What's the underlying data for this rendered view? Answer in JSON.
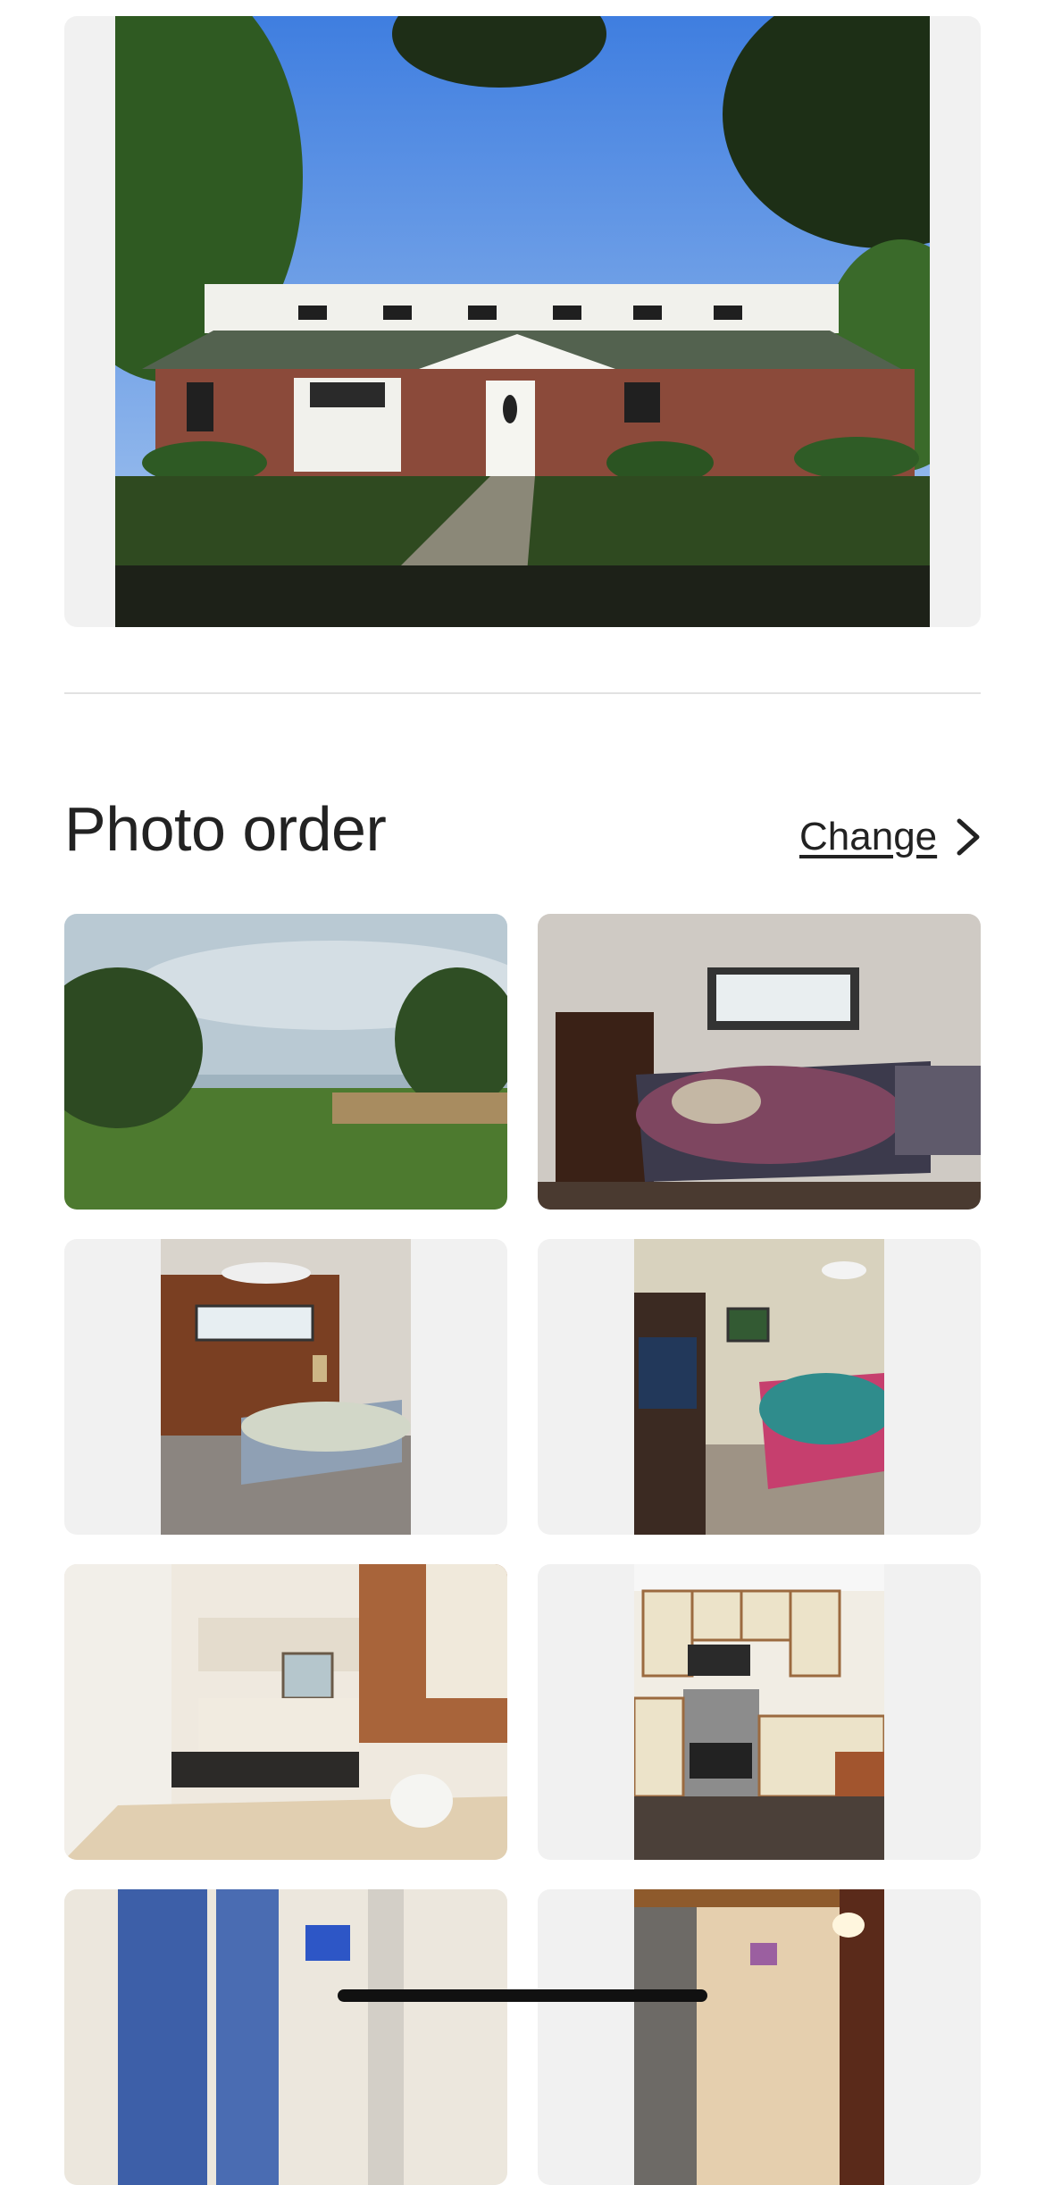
{
  "cover_photo": {
    "description": "House exterior - cover photo"
  },
  "photo_order": {
    "title": "Photo order",
    "change_label": "Change",
    "icon": "chevron-right-icon"
  },
  "photos": [
    {
      "name": "lake-lawn"
    },
    {
      "name": "bedroom-floral-bed"
    },
    {
      "name": "bedroom-wood-paneling"
    },
    {
      "name": "bedroom-bunk-bed"
    },
    {
      "name": "kitchen-wide"
    },
    {
      "name": "kitchen-stove"
    },
    {
      "name": "bathroom-blue-curtain"
    },
    {
      "name": "bathroom-tile"
    }
  ],
  "colors": {
    "text": "#222222",
    "tile_bg": "#f1f1f1",
    "divider": "#e2e2e2"
  }
}
